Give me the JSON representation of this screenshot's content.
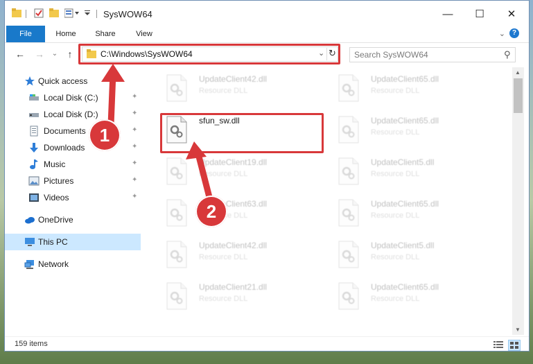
{
  "window": {
    "title": "SysWOW64",
    "minimize_glyph": "—",
    "maximize_glyph": "☐",
    "close_glyph": "✕"
  },
  "ribbon": {
    "tabs": [
      "File",
      "Home",
      "Share",
      "View"
    ],
    "help_glyph": "?",
    "collapse_glyph": "⌄"
  },
  "nav": {
    "back_glyph": "←",
    "forward_glyph": "→",
    "up_glyph": "↑",
    "recent_glyph": "⌄",
    "address": "C:\\Windows\\SysWOW64",
    "address_dropdown_glyph": "⌄",
    "refresh_glyph": "↻",
    "search_placeholder": "Search SysWOW64",
    "search_glyph": "⚲"
  },
  "sidebar": {
    "items": [
      {
        "label": "Quick access",
        "icon": "star-icon"
      },
      {
        "label": "Local Disk (C:)",
        "icon": "drive-icon"
      },
      {
        "label": "Local Disk (D:)",
        "icon": "drive-icon"
      },
      {
        "label": "Documents",
        "icon": "documents-icon"
      },
      {
        "label": "Downloads",
        "icon": "downloads-icon"
      },
      {
        "label": "Music",
        "icon": "music-icon"
      },
      {
        "label": "Pictures",
        "icon": "pictures-icon"
      },
      {
        "label": "Videos",
        "icon": "videos-icon"
      },
      {
        "label": "OneDrive",
        "icon": "onedrive-icon"
      },
      {
        "label": "This PC",
        "icon": "this-pc-icon"
      },
      {
        "label": "Network",
        "icon": "network-icon"
      }
    ],
    "pin_glyph": "📌"
  },
  "files": {
    "items": [
      {
        "name": "UpdateClient42.dll",
        "type": "Resource DLL"
      },
      {
        "name": "UpdateClient65.dll",
        "type": "Resource DLL"
      },
      {
        "name": "sfun_sw.dll",
        "type": ""
      },
      {
        "name": "UpdateClient65.dll",
        "type": "Resource DLL"
      },
      {
        "name": "UpdateClient19.dll",
        "type": "Resource DLL"
      },
      {
        "name": "UpdateClient5.dll",
        "type": "Resource DLL"
      },
      {
        "name": "UpdateClient63.dll",
        "type": "Resource DLL"
      },
      {
        "name": "UpdateClient65.dll",
        "type": "Resource DLL"
      },
      {
        "name": "UpdateClient42.dll",
        "type": "Resource DLL"
      },
      {
        "name": "UpdateClient5.dll",
        "type": "Resource DLL"
      },
      {
        "name": "UpdateClient21.dll",
        "type": "Resource DLL"
      },
      {
        "name": "UpdateClient65.dll",
        "type": "Resource DLL"
      }
    ]
  },
  "status": {
    "item_count": "159 items"
  },
  "scrollbar": {
    "up_glyph": "▲",
    "down_glyph": "▼"
  },
  "annotations": {
    "callout_1": "1",
    "callout_2": "2"
  },
  "colors": {
    "accent": "#1979ca",
    "highlight": "#d8383a",
    "selected": "#cce8ff"
  }
}
